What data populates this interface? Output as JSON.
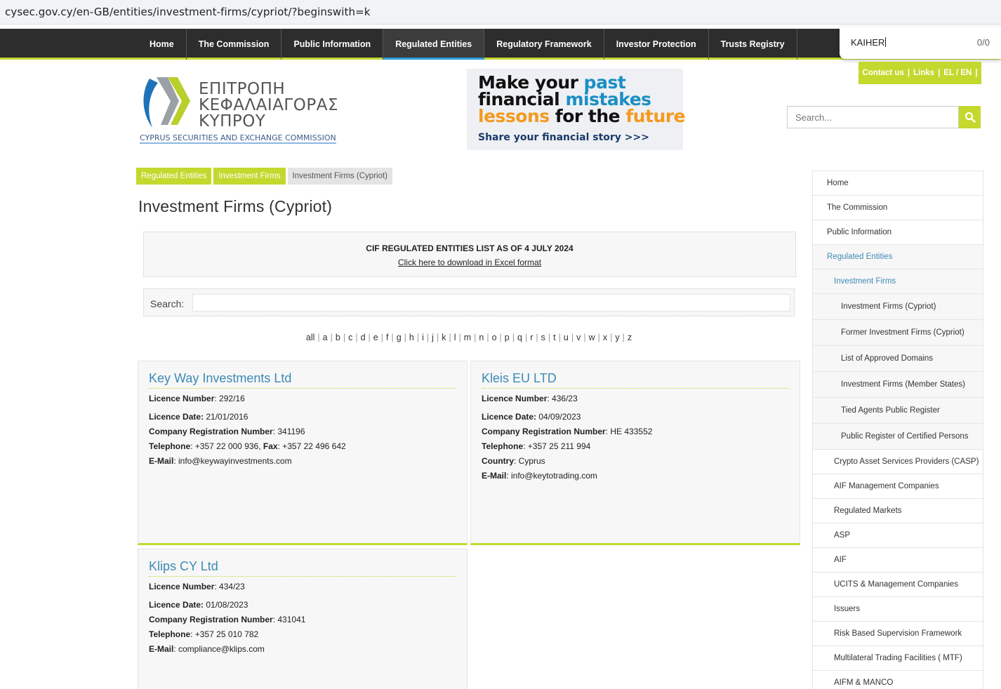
{
  "browser": {
    "url": "cysec.gov.cy/en-GB/entities/investment-firms/cypriot/?beginswith=k"
  },
  "find_bar": {
    "query": "KAIHER",
    "count": "0/0"
  },
  "top_nav": {
    "items": [
      "Home",
      "The Commission",
      "Public Information",
      "Regulated Entities",
      "Regulatory Framework",
      "Investor Protection",
      "Trusts Registry"
    ],
    "active": "Regulated Entities"
  },
  "contact_bar": {
    "contact": "Contact us",
    "links": "Links",
    "lang": "EL / EN",
    "sep": "|"
  },
  "logo": {
    "greek_line1": "ΕΠΙΤΡΟΠΗ",
    "greek_line2": "ΚΕΦΑΛΑΙΑΓΟΡΑΣ",
    "greek_line3": "ΚΥΠΡΟΥ",
    "english": "CYPRUS SECURITIES AND EXCHANGE COMMISSION"
  },
  "banner": {
    "line1_a": "Make your ",
    "line1_b": "past",
    "line2_a": "financial ",
    "line2_b": "mistakes",
    "line3_a": "lessons",
    "line3_b": " for the ",
    "line3_c": "future",
    "cta": "Share your financial story >>>",
    "colors": {
      "dark": "#111111",
      "blue": "#1b8fc4",
      "orange": "#f39a1f"
    }
  },
  "site_search": {
    "placeholder": "Search..."
  },
  "breadcrumb": [
    "Regulated Entities",
    "Investment Firms",
    "Investment Firms (Cypriot)"
  ],
  "page_title": "Investment Firms (Cypriot)",
  "cif_box": {
    "title": "CIF REGULATED ENTITIES LIST AS OF 4 JULY 2024",
    "download": "Click here to download in Excel format"
  },
  "table_search": {
    "label": "Search:",
    "value": ""
  },
  "alphabet": [
    "all",
    "a",
    "b",
    "c",
    "d",
    "e",
    "f",
    "g",
    "h",
    "i",
    "j",
    "k",
    "l",
    "m",
    "n",
    "o",
    "p",
    "q",
    "r",
    "s",
    "t",
    "u",
    "v",
    "w",
    "x",
    "y",
    "z"
  ],
  "firms": [
    {
      "name": "Key Way Investments Ltd",
      "rows": [
        {
          "k1": "Licence Number",
          "v1": ": 292/16"
        },
        {
          "k1": "Licence Date:",
          "v1": " 21/01/2016"
        },
        {
          "k1": "Company Registration Number",
          "v1": ": 341196"
        },
        {
          "k1": "Telephone",
          "v1": ": +357 22 000 936, ",
          "k2": "Fax",
          "v2": ": +357 22 496 642"
        },
        {
          "k1": "E-Mail",
          "v1": ": info@keywayinvestments.com"
        }
      ]
    },
    {
      "name": "Kleis EU LTD",
      "rows": [
        {
          "k1": "Licence Number",
          "v1": ": 436/23"
        },
        {
          "k1": "Licence Date:",
          "v1": " 04/09/2023"
        },
        {
          "k1": "Company Registration Number",
          "v1": ": HE 433552"
        },
        {
          "k1": "Telephone",
          "v1": ": +357 25 211 994"
        },
        {
          "k1": "Country",
          "v1": ": Cyprus"
        },
        {
          "k1": "E-Mail",
          "v1": ": info@keytotrading.com"
        }
      ]
    },
    {
      "name": "Klips CY Ltd",
      "rows": [
        {
          "k1": "Licence Number",
          "v1": ": 434/23"
        },
        {
          "k1": "Licence Date:",
          "v1": " 01/08/2023"
        },
        {
          "k1": "Company Registration Number",
          "v1": ": 431041"
        },
        {
          "k1": "Telephone",
          "v1": ": +357 25 010 782"
        },
        {
          "k1": "E-Mail",
          "v1": ": compliance@klips.com"
        }
      ]
    }
  ],
  "side_menu": [
    {
      "label": "Home",
      "level": 0
    },
    {
      "label": "The Commission",
      "level": 0
    },
    {
      "label": "Public Information",
      "level": 0
    },
    {
      "label": "Regulated Entities",
      "level": 0,
      "highlight": true
    },
    {
      "label": "Investment Firms",
      "level": 1,
      "highlight": true
    },
    {
      "label": "Investment Firms (Cypriot)",
      "level": 2
    },
    {
      "label": "Former Investment Firms (Cypriot)",
      "level": 2
    },
    {
      "label": "List of Approved Domains",
      "level": 2
    },
    {
      "label": "Investment Firms (Member States)",
      "level": 2
    },
    {
      "label": "Tied Agents Public Register",
      "level": 2
    },
    {
      "label": "Public Register of Certified Persons",
      "level": 2
    },
    {
      "label": "Crypto Asset Services Providers (CASP)",
      "level": 1
    },
    {
      "label": "AIF Management Companies",
      "level": 1
    },
    {
      "label": "Regulated Markets",
      "level": 1
    },
    {
      "label": "ASP",
      "level": 1
    },
    {
      "label": "AIF",
      "level": 1
    },
    {
      "label": "UCITS & Management Companies",
      "level": 1
    },
    {
      "label": "Issuers",
      "level": 1
    },
    {
      "label": "Risk Based Supervision Framework",
      "level": 1
    },
    {
      "label": "Multilateral Trading Facilities ( MTF)",
      "level": 1
    },
    {
      "label": "AIFM & MANCO",
      "level": 1
    }
  ],
  "colors": {
    "accent_green": "#c4d82e",
    "link_blue": "#3d8ab5",
    "nav_dark": "#2d2d2d"
  }
}
